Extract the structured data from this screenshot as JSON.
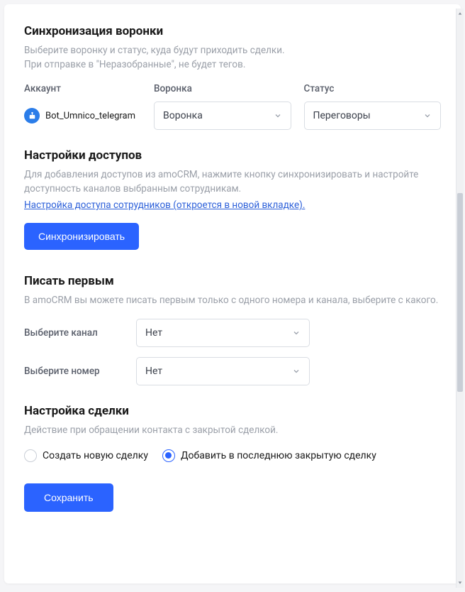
{
  "sync": {
    "title": "Синхронизация воронки",
    "desc": "Выберите воронку и статус, куда будут приходить сделки.\nПри отправке в \"Неразобранные\", не будет тегов.",
    "account_label": "Аккаунт",
    "pipeline_label": "Воронка",
    "status_label": "Статус",
    "account_name": "Bot_Umnico_telegram",
    "pipeline_value": "Воронка",
    "status_value": "Переговоры"
  },
  "access": {
    "title": "Настройки доступов",
    "desc": "Для добавления доступов из amoCRM, нажмите кнопку синхронизировать и настройте доступность каналов выбранным сотрудникам.",
    "link": "Настройка доступа сотрудников (откроется в новой вкладке).",
    "sync_button": "Синхронизировать"
  },
  "write_first": {
    "title": "Писать первым",
    "desc": "В amoCRM вы можете писать первым только с одного номера и канала, выберите с какого.",
    "channel_label": "Выберите канал",
    "channel_value": "Нет",
    "number_label": "Выберите номер",
    "number_value": "Нет"
  },
  "deal": {
    "title": "Настройка сделки",
    "desc": "Действие при обращении контакта с закрытой сделкой.",
    "option_new": "Создать новую сделку",
    "option_append": "Добавить в последнюю закрытую сделку",
    "selected": "append"
  },
  "footer": {
    "save_button": "Сохранить"
  }
}
